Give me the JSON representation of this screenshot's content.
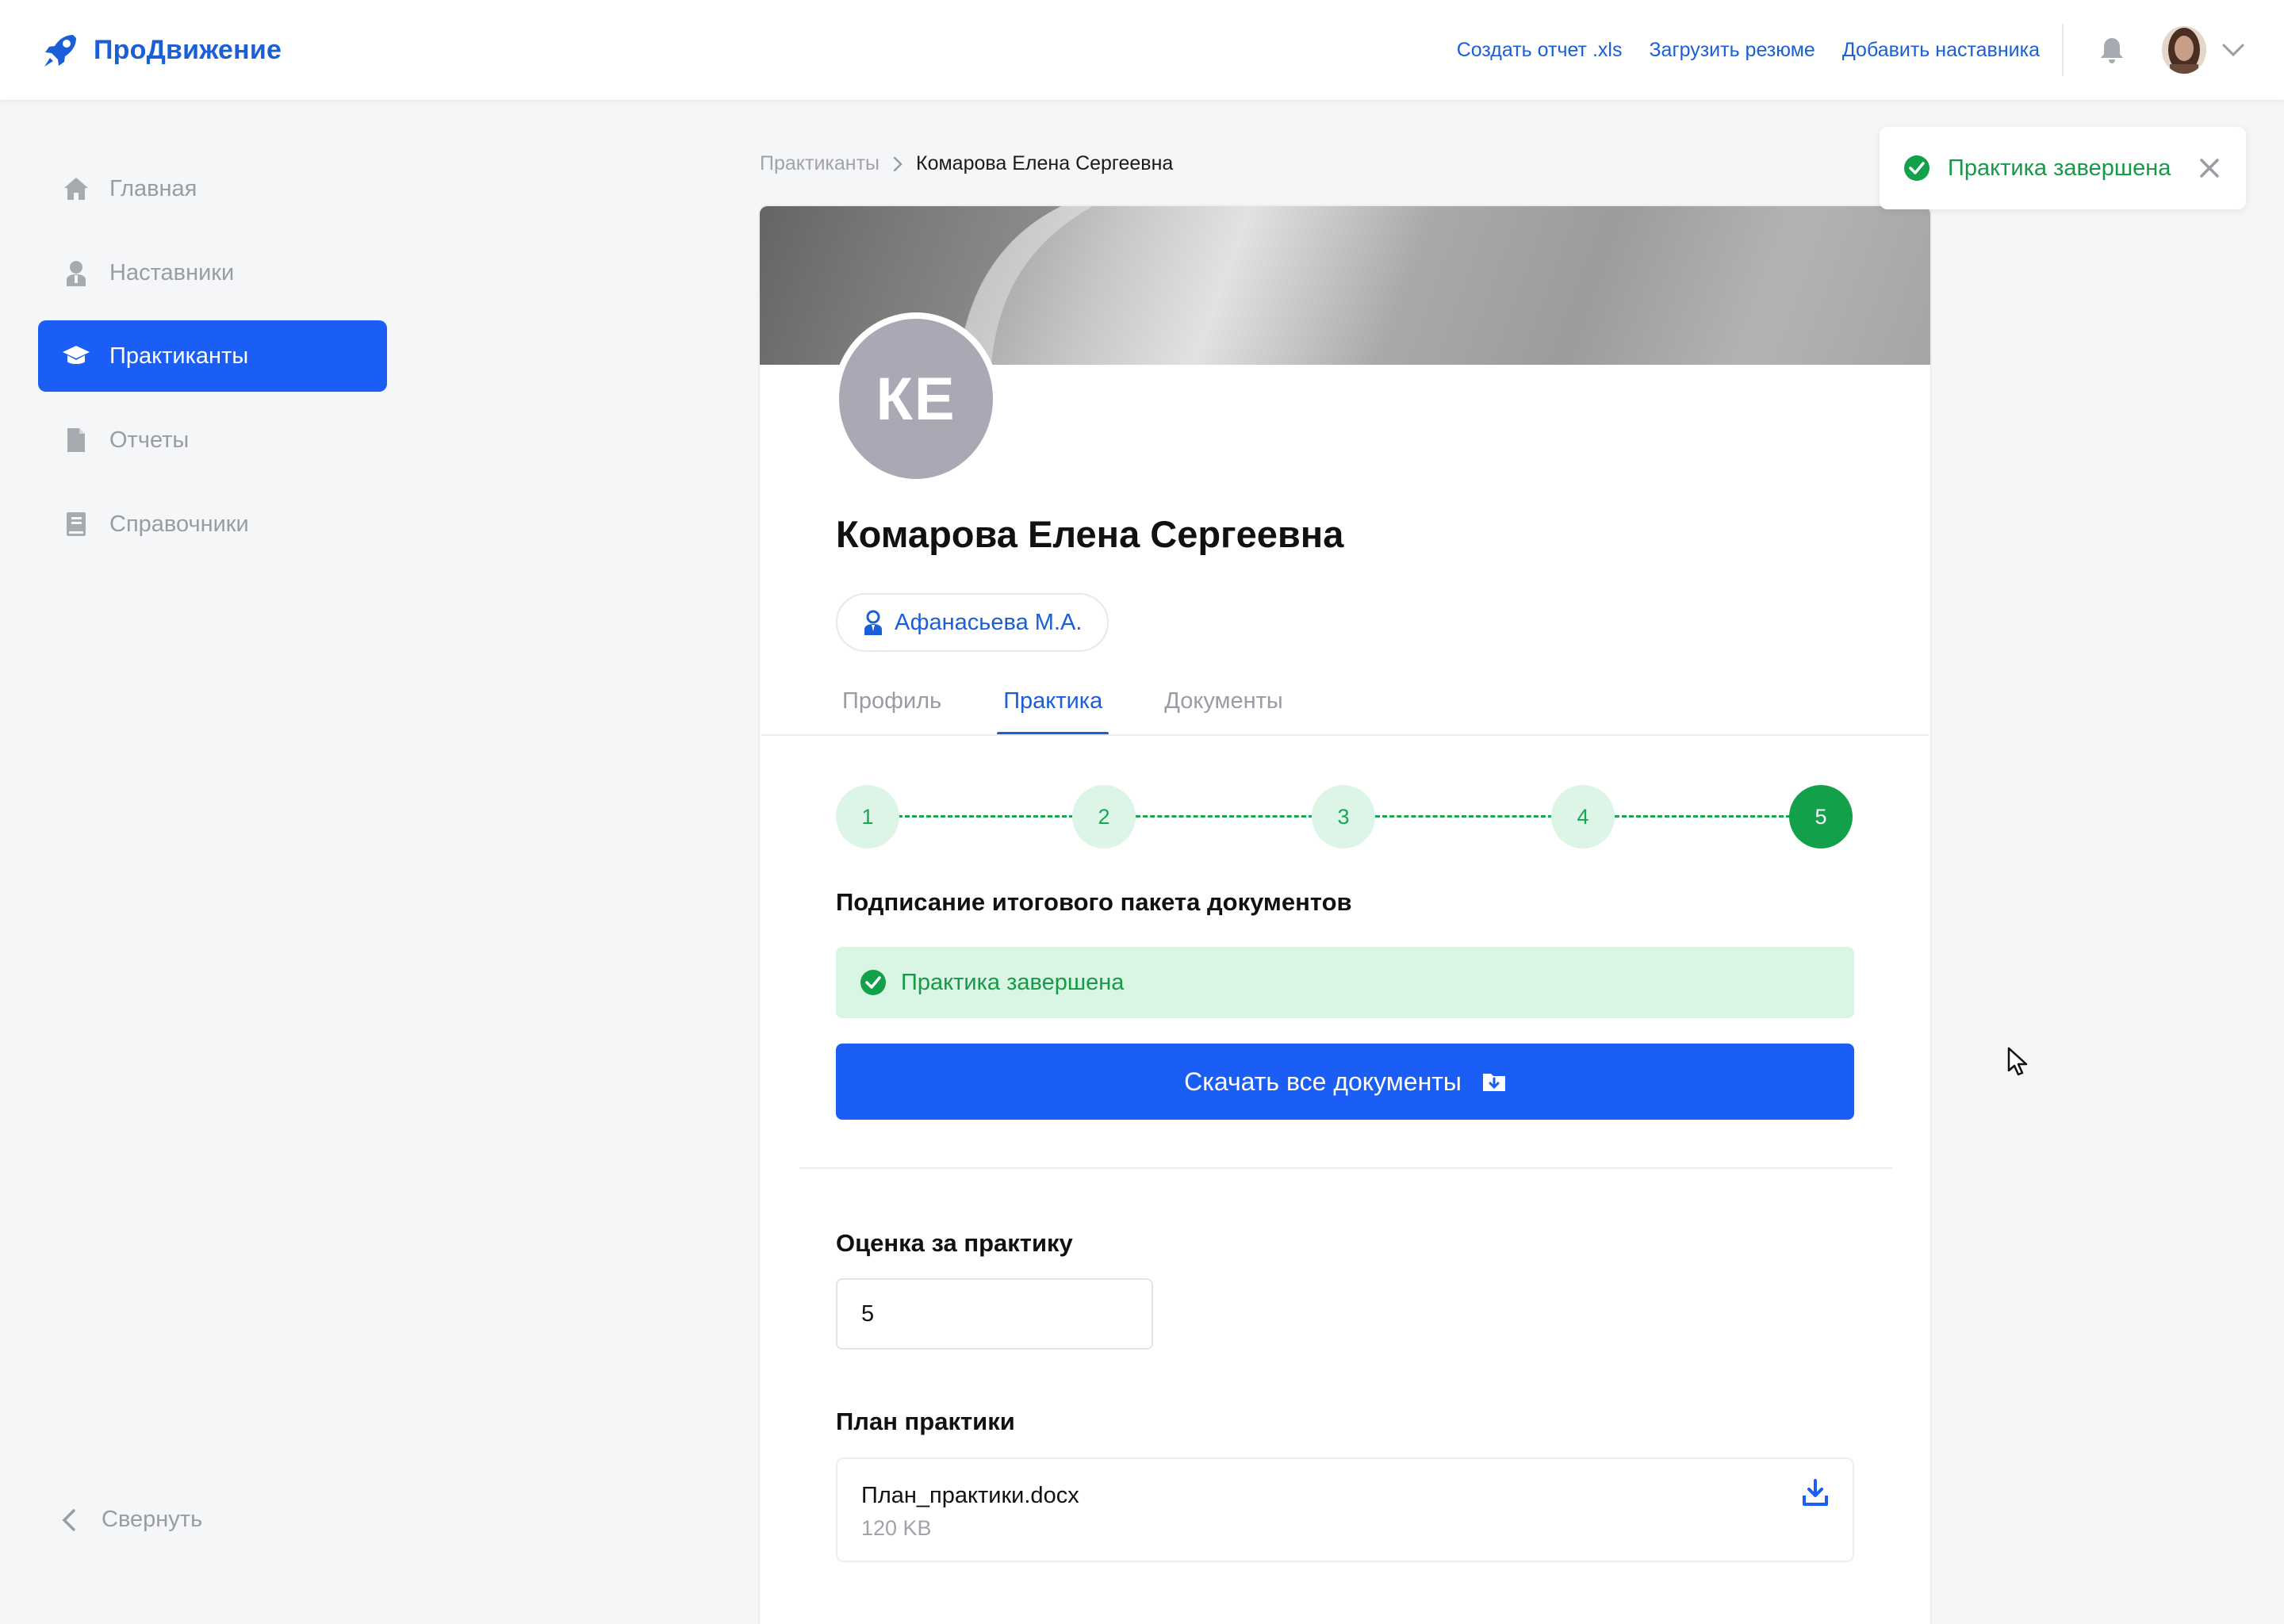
{
  "app": {
    "name": "ПроДвижение"
  },
  "header": {
    "links": [
      "Создать отчет .xls",
      "Загрузить резюме",
      "Добавить наставника"
    ]
  },
  "sidebar": {
    "items": [
      {
        "label": "Главная",
        "icon": "home-icon"
      },
      {
        "label": "Наставники",
        "icon": "mentor-icon"
      },
      {
        "label": "Практиканты",
        "icon": "graduation-cap-icon",
        "active": true
      },
      {
        "label": "Отчеты",
        "icon": "document-icon"
      },
      {
        "label": "Справочники",
        "icon": "book-icon"
      }
    ],
    "collapse_label": "Свернуть"
  },
  "breadcrumb": {
    "root": "Практиканты",
    "current": "Комарова Елена Сергеевна"
  },
  "profile": {
    "initials": "КЕ",
    "name": "Комарова Елена Сергеевна",
    "mentor": "Афанасьева М.А."
  },
  "tabs": [
    "Профиль",
    "Практика",
    "Документы"
  ],
  "active_tab": "Практика",
  "stepper": {
    "steps": [
      "1",
      "2",
      "3",
      "4",
      "5"
    ],
    "current": "5"
  },
  "practice": {
    "stage_title": "Подписание итогового пакета документов",
    "status_text": "Практика завершена",
    "download_all_label": "Скачать все документы",
    "grade_title": "Оценка за практику",
    "grade_value": "5",
    "plan_title": "План практики",
    "plan_file": {
      "name": "План_практики.docx",
      "size": "120 KB"
    }
  },
  "toast": {
    "text": "Практика завершена"
  },
  "colors": {
    "primary": "#1a5ef5",
    "success": "#169a48",
    "success_bg": "#d8f6e3",
    "muted": "#9a9ca3"
  }
}
